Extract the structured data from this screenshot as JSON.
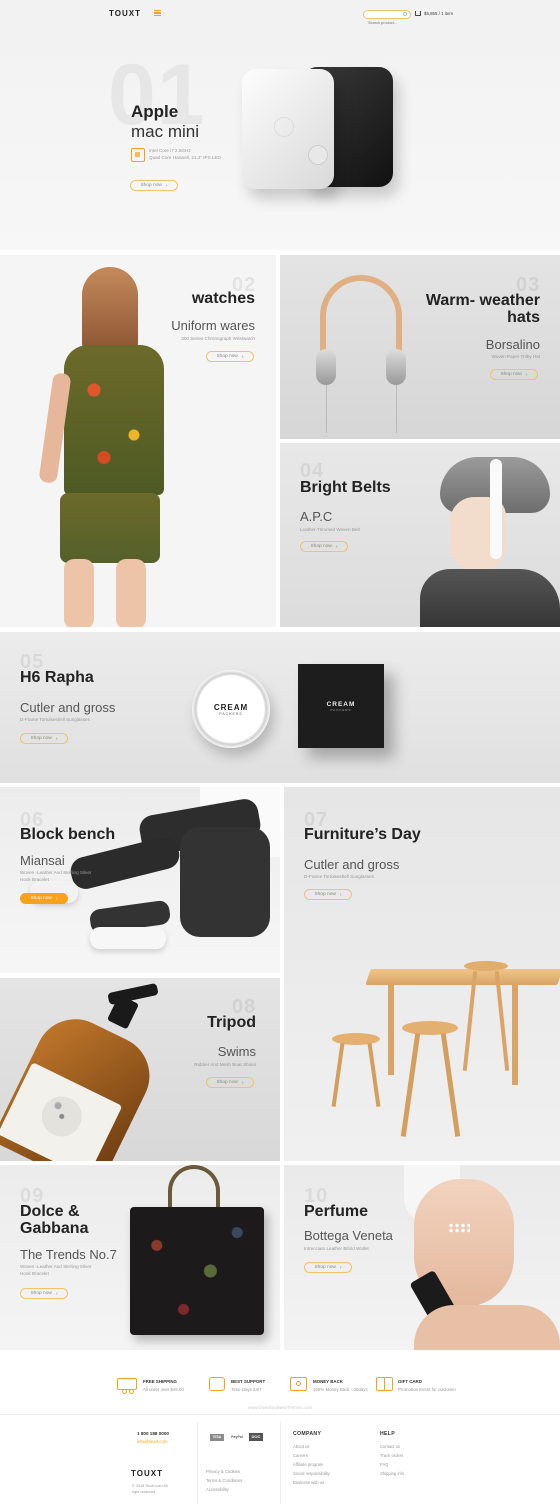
{
  "header": {
    "logo": "TOUXT",
    "search_placeholder": "Search product...",
    "cart_text": "$5,865 / 1 item"
  },
  "hero": {
    "number": "01",
    "title_line1": "Apple",
    "title_line2": "mac mini",
    "spec_line1": "Intel Core i7 2.5GHz",
    "spec_line2": "Quad Core Haswell, 21.4\" IPS LED",
    "button": "Shop now"
  },
  "tiles": [
    {
      "number": "02",
      "title": "watches",
      "subtitle": "Uniform wares",
      "desc": "300 Series Chronograph Wristwatch",
      "button": "Shop now"
    },
    {
      "number": "03",
      "title": "Warm- weather hats",
      "subtitle": "Borsalino",
      "desc": "Woven Paper Trilby Hat",
      "button": "Shop now"
    },
    {
      "number": "04",
      "title": "Bright Belts",
      "subtitle": "A.P.C",
      "desc": "Leather-Trimmed Woven Belt",
      "button": "Shop now"
    },
    {
      "number": "05",
      "title": "H6 Rapha",
      "subtitle": "Cutler and gross",
      "desc": "D-Frame Tortoiseshell Sunglasses",
      "button": "Shop now"
    },
    {
      "number": "06",
      "title": "Block bench",
      "subtitle": "Miansai",
      "desc": "Woven -Leather And Sterling Silver Hook Bracelet",
      "button": "Shop now"
    },
    {
      "number": "07",
      "title": "Furniture’s Day",
      "subtitle": "Cutler and gross",
      "desc": "D-Frame Tortoiseshell Sunglasses",
      "button": "Shop now"
    },
    {
      "number": "08",
      "title": "Tripod",
      "subtitle": "Swims",
      "desc": "Rubber And Mesh Boat Shoes",
      "button": "Shop now"
    },
    {
      "number": "09",
      "title": "Dolce & Gabbana",
      "subtitle": "The Trends No.7",
      "desc": "Woven -Leather And Sterling Silver Hook Bracelet",
      "button": "Shop now"
    },
    {
      "number": "10",
      "title": "Perfume",
      "subtitle": "Bottega Veneta",
      "desc": "Intrecciato Leather Bifold Wallet",
      "button": "Shop now"
    }
  ],
  "box_text": {
    "cream": "CREAM",
    "packers": "PACKERS"
  },
  "features": [
    {
      "title": "FREE SHIPPING",
      "desc": "All order over $49.00",
      "icon": "truck-icon"
    },
    {
      "title": "BEST SUPPORT",
      "desc": "Time Days 24/7",
      "icon": "support-icon"
    },
    {
      "title": "MONEY BACK",
      "desc": "100% Money Back - 30days",
      "icon": "money-icon"
    },
    {
      "title": "GIFT CARD",
      "desc": "Promotion Event for customer",
      "icon": "gift-icon"
    }
  ],
  "watermark": "www.DownloadNewThemes.com",
  "footer": {
    "phone": "1 800 188 0000",
    "email": "info@touxt.com",
    "logo": "TOUXT",
    "copyright": "© 2018 Touxt.com All right reserved",
    "payments": [
      "VISA",
      "PayPal",
      "DOC"
    ],
    "legal_links": [
      "Privacy & Cookies",
      "Terms & Conditions",
      "Accessibility"
    ],
    "company_head": "COMPANY",
    "company_links": [
      "About us",
      "Careers",
      "Affiliate program",
      "Social responsibility",
      "Business with us"
    ],
    "help_head": "HELP",
    "help_links": [
      "Contact us",
      "Track orders",
      "FAQ",
      "Shipping info"
    ]
  },
  "colors": {
    "accent": "#f6a21a",
    "text": "#222222",
    "muted": "#999999"
  }
}
